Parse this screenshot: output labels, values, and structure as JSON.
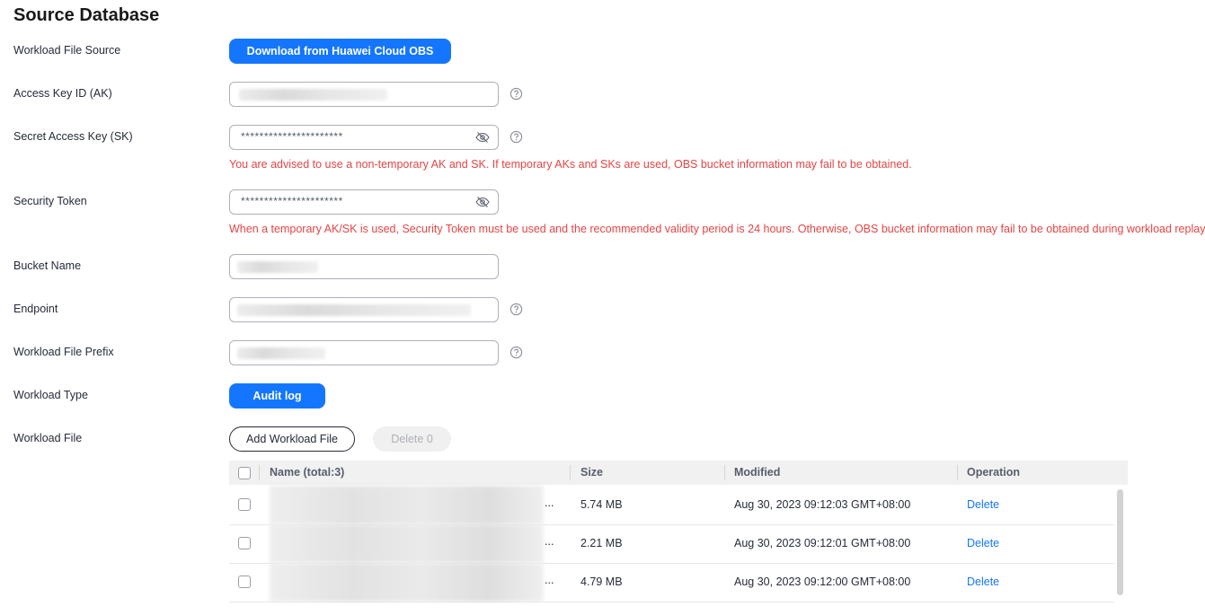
{
  "page": {
    "title": "Source Database"
  },
  "form": {
    "workload_file_source": {
      "label": "Workload File Source",
      "button": "Download from Huawei Cloud OBS"
    },
    "access_key": {
      "label": "Access Key ID (AK)"
    },
    "secret_key": {
      "label": "Secret Access Key (SK)",
      "value": "**********************",
      "warning": "You are advised to use a non-temporary AK and SK. If temporary AKs and SKs are used, OBS bucket information may fail to be obtained."
    },
    "security_token": {
      "label": "Security Token",
      "value": "**********************",
      "warning": "When a temporary AK/SK is used, Security Token must be used and the recommended validity period is 24 hours. Otherwise, OBS bucket information may fail to be obtained during workload replay."
    },
    "bucket_name": {
      "label": "Bucket Name"
    },
    "endpoint": {
      "label": "Endpoint"
    },
    "workload_file_prefix": {
      "label": "Workload File Prefix"
    },
    "workload_type": {
      "label": "Workload Type",
      "button": "Audit log"
    },
    "workload_file": {
      "label": "Workload File",
      "add_button": "Add Workload File",
      "delete_button": "Delete 0"
    }
  },
  "table": {
    "headers": {
      "name": "Name (total:3)",
      "size": "Size",
      "modified": "Modified",
      "operation": "Operation"
    },
    "rows": [
      {
        "name_suffix": "...",
        "size": "5.74 MB",
        "modified": "Aug 30, 2023 09:12:03 GMT+08:00",
        "action": "Delete"
      },
      {
        "name_suffix": "...",
        "size": "2.21 MB",
        "modified": "Aug 30, 2023 09:12:01 GMT+08:00",
        "action": "Delete"
      },
      {
        "name_suffix": "...",
        "size": "4.79 MB",
        "modified": "Aug 30, 2023 09:12:00 GMT+08:00",
        "action": "Delete"
      }
    ]
  },
  "icons": {
    "help": "question-circle-icon",
    "eye": "eye-hidden-icon"
  },
  "colors": {
    "primary": "#1476ff",
    "warning": "#e54545",
    "link": "#1476ff"
  }
}
